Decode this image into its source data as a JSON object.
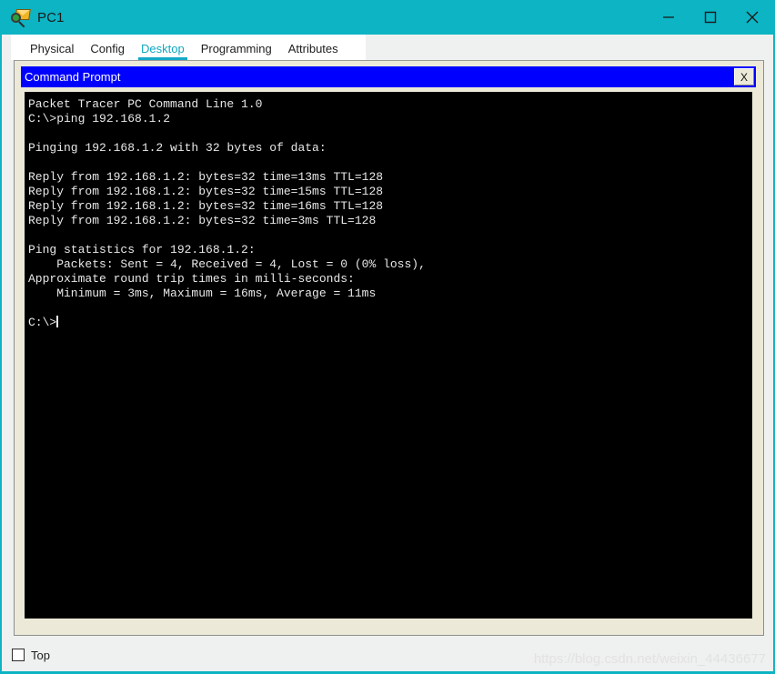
{
  "window": {
    "title": "PC1",
    "icon": "packet-tracer-magnifier-icon",
    "controls": {
      "minimize_label": "Minimize",
      "maximize_label": "Maximize",
      "close_label": "Close"
    }
  },
  "tabs": [
    {
      "label": "Physical",
      "active": false
    },
    {
      "label": "Config",
      "active": false
    },
    {
      "label": "Desktop",
      "active": true
    },
    {
      "label": "Programming",
      "active": false
    },
    {
      "label": "Attributes",
      "active": false
    }
  ],
  "command_prompt": {
    "title": "Command Prompt",
    "close_button_label": "X",
    "terminal_lines": [
      "Packet Tracer PC Command Line 1.0",
      "C:\\>ping 192.168.1.2",
      "",
      "Pinging 192.168.1.2 with 32 bytes of data:",
      "",
      "Reply from 192.168.1.2: bytes=32 time=13ms TTL=128",
      "Reply from 192.168.1.2: bytes=32 time=15ms TTL=128",
      "Reply from 192.168.1.2: bytes=32 time=16ms TTL=128",
      "Reply from 192.168.1.2: bytes=32 time=3ms TTL=128",
      "",
      "Ping statistics for 192.168.1.2:",
      "    Packets: Sent = 4, Received = 4, Lost = 0 (0% loss),",
      "Approximate round trip times in milli-seconds:",
      "    Minimum = 3ms, Maximum = 16ms, Average = 11ms",
      "",
      ""
    ],
    "prompt": "C:\\>"
  },
  "footer": {
    "top_checkbox_label": "Top",
    "top_checkbox_checked": false,
    "watermark": "https://blog.csdn.net/weixin_44436677"
  },
  "colors": {
    "titlebar_teal": "#0cb4c4",
    "tab_active": "#16a8c7",
    "cmd_titlebar_blue": "#0000ff",
    "terminal_bg": "#000000",
    "terminal_text": "#e8e8e8",
    "panel_beige": "#ece9d8"
  }
}
